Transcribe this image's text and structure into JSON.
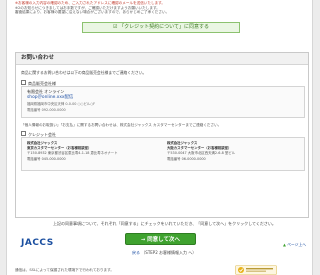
{
  "notes": {
    "line1": "※お客様の入力内容の確認のため、ご入力されたアドレスに確認のメールを送信いたします。",
    "line2": "※2のお知らせにつきましてはお手数ですが、ご確認いただけますようお願いいたします。",
    "line3": "審査結果により、お客様の要望に沿えない場合がございますので、あらかじめご了承ください。"
  },
  "terms_check": {
    "label": "「クレジット契約について」に同意する"
  },
  "inquiry": {
    "title": "お問い合わせ",
    "intro": "商品に関するお問い合わせは以下の商品販売会社様までご連絡ください。",
    "seller_heading": "商品販売会社様",
    "seller": {
      "name": "有限会社 オンライン",
      "email": "shop＠online.xxx配信",
      "address": "福岡県福岡市中央区天神 0-0-00 ○○ビル○F",
      "tel": "電話番号 092-000-0000"
    },
    "note": "「個人情報のお取扱い」「お支払」に関するお問い合わせは、株式会社ジャックス カスタマーセンターまでご連絡ください。",
    "credit_heading": "クレジット会社",
    "credit_left": {
      "company": "株式会社ジャックス",
      "center": "東京カスタマーセンター（お客様相談室）",
      "address": "〒150-8932 東京都渋谷区恵比寿4-1-18 恵比寿ネオナート",
      "tel": "電話番号 045-000-0000"
    },
    "credit_right": {
      "company": "株式会社ジャックス",
      "center": "大阪カスタマーセンター（お客様相談室）",
      "address": "〒530-0047 大阪市北区西天満2-6-8 堂ビル",
      "tel": "電話番号 06-0000-0000"
    }
  },
  "instruction": "上記の同意事項について、それぞれ「同意する」にチェックをいれていただき、「同意して次へ」をクリックしてください。",
  "confirm_button": {
    "label": "同意して次へ",
    "arrow": "→"
  },
  "back_link": {
    "prefix": "戻る",
    "label": "（STEP2 お客様情報入力 へ）"
  },
  "to_top": {
    "arrow": "▲",
    "label": "ページ上へ"
  },
  "logo_text": "JACCS",
  "footer_note": "通信は、SSLによって保護された環境下で行われております。",
  "colors": {
    "brand": "#1b4fa0",
    "accent": "#3fa22f",
    "logo_accent": "#e05b22"
  }
}
